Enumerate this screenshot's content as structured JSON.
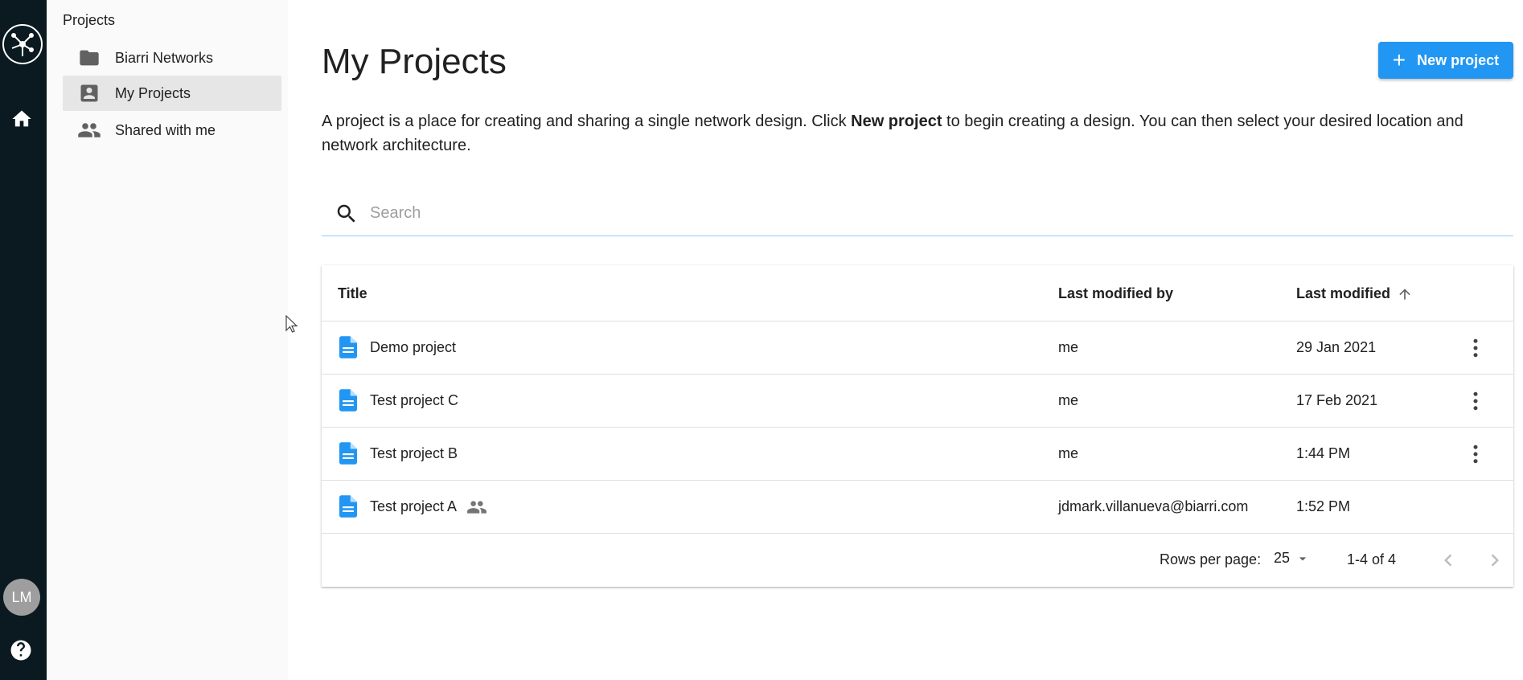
{
  "rail": {
    "avatar_initials": "LM"
  },
  "sidebar": {
    "section_title": "Projects",
    "items": [
      {
        "label": "Biarri Networks",
        "icon": "folder-icon"
      },
      {
        "label": "My Projects",
        "icon": "account-box-icon",
        "active": true
      },
      {
        "label": "Shared with me",
        "icon": "people-icon"
      }
    ]
  },
  "main": {
    "title": "My Projects",
    "new_button_label": "New project",
    "description": {
      "before": "A project is a place for creating and sharing a single network design. Click ",
      "bold": "New project",
      "after": " to begin creating a design. You can then select your desired location and network architecture."
    },
    "search": {
      "placeholder": "Search",
      "value": ""
    }
  },
  "table": {
    "columns": [
      "Title",
      "Last modified by",
      "Last modified"
    ],
    "rows": [
      {
        "title": "Demo project",
        "modified_by": "me",
        "modified": "29 Jan 2021",
        "shared": false,
        "has_menu": true
      },
      {
        "title": "Test project C",
        "modified_by": "me",
        "modified": "17 Feb 2021",
        "shared": false,
        "has_menu": true
      },
      {
        "title": "Test project B",
        "modified_by": "me",
        "modified": "1:44 PM",
        "shared": false,
        "has_menu": true
      },
      {
        "title": "Test project A",
        "modified_by": "jdmark.villanueva@biarri.com",
        "modified": "1:52 PM",
        "shared": true,
        "has_menu": false
      }
    ],
    "footer": {
      "rows_per_page_label": "Rows per page:",
      "rows_per_page_value": "25",
      "range": "1-4 of 4"
    }
  },
  "colors": {
    "rail_bg": "#0b1a20",
    "accent": "#2196f3",
    "sidebar_bg": "#fafafa",
    "active_item_bg": "#e6e6e6"
  }
}
